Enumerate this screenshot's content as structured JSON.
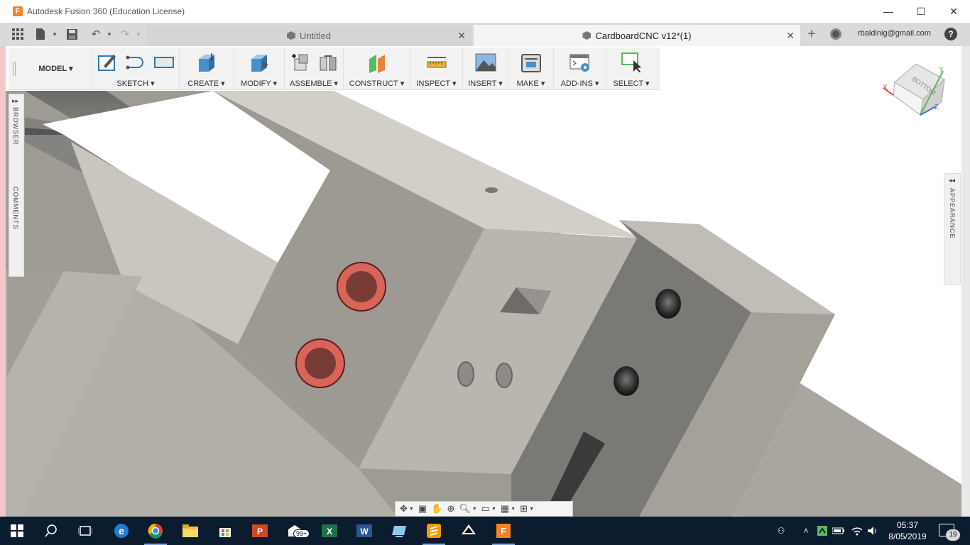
{
  "window": {
    "app_icon": "F",
    "title": "Autodesk Fusion 360 (Education License)",
    "controls": {
      "minimize": "—",
      "maximize": "☐",
      "close": "✕"
    }
  },
  "tabs": {
    "inactive": {
      "label": "Untitled",
      "close": "✕"
    },
    "active": {
      "label": "CardboardCNC v12*(1)",
      "close": "✕"
    },
    "add": "+",
    "user_email": "rbaldinig@gmail.com",
    "help": "?"
  },
  "toolbar": {
    "workspace": "MODEL",
    "groups": [
      {
        "label": "SKETCH"
      },
      {
        "label": "CREATE"
      },
      {
        "label": "MODIFY"
      },
      {
        "label": "ASSEMBLE"
      },
      {
        "label": "CONSTRUCT"
      },
      {
        "label": "INSPECT"
      },
      {
        "label": "INSERT"
      },
      {
        "label": "MAKE"
      },
      {
        "label": "ADD-INS"
      },
      {
        "label": "SELECT"
      }
    ]
  },
  "panels": {
    "browser": "BROWSER",
    "comments": "COMMENTS",
    "appearance": "APPEARANCE"
  },
  "viewcube": {
    "face_label": "BOTTOM",
    "x_axis": "X",
    "y_axis": "Y",
    "z_axis": "Z"
  },
  "taskbar": {
    "store_badge": "99+",
    "clock_time": "05:37",
    "clock_date": "8/05/2019",
    "notification_count": "19"
  },
  "colors": {
    "accent": "#f58220",
    "taskbar": "#0b1c2e",
    "model_surface": "#a8a49e",
    "decal": "#d9645a"
  }
}
